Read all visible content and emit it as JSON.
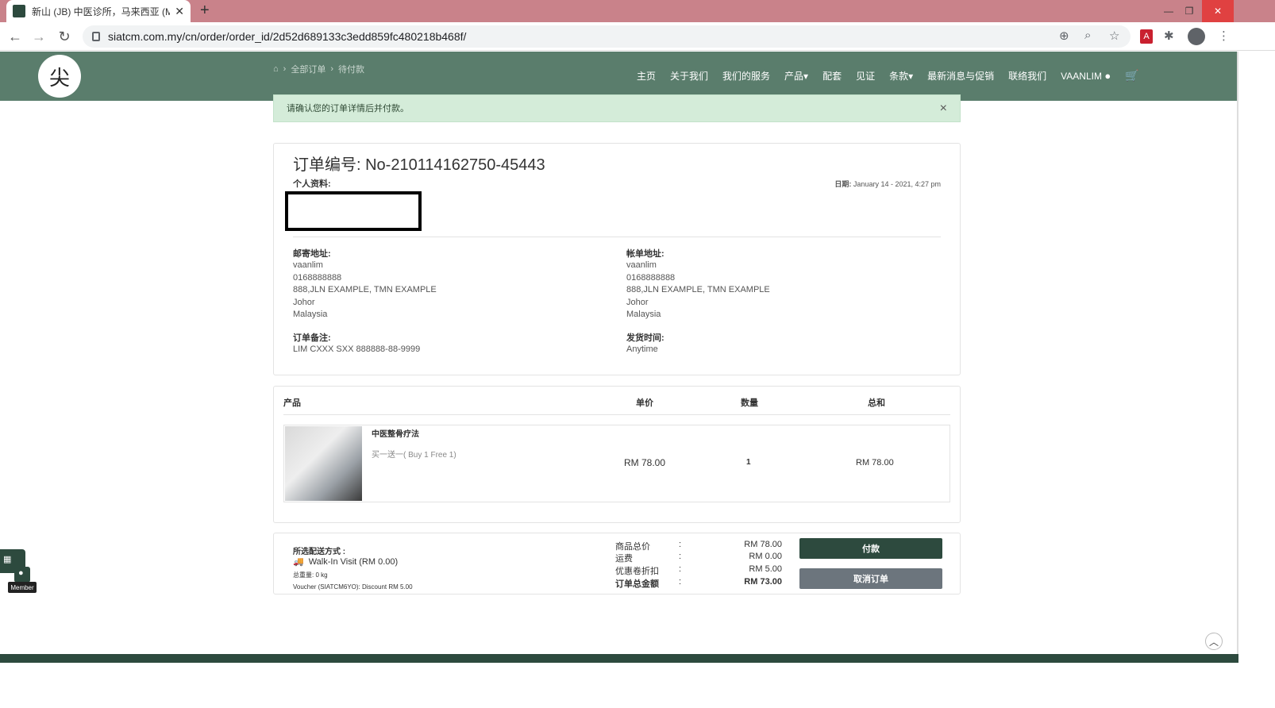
{
  "browser": {
    "tab_title": "新山 (JB) 中医诊所，马来西亚 (M",
    "tab_close": "✕",
    "new_tab": "+",
    "url": "siatcm.com.my/cn/order/order_id/2d52d689133c3edd859fc480218b468f/",
    "window_min": "—",
    "window_restore": "❐",
    "window_close": "✕"
  },
  "header": {
    "logo_glyph": "尖",
    "breadcrumb": [
      "⌂",
      "全部订单",
      "待付款"
    ],
    "menu": [
      "主页",
      "关于我们",
      "我们的服务",
      "产品▾",
      "配套",
      "见证",
      "条款▾",
      "最新消息与促销",
      "联络我们",
      "VAANLIM"
    ]
  },
  "alert": {
    "text": "请确认您的订单详情后并付款。",
    "close": "×"
  },
  "order": {
    "title": "订单编号: No-210114162750-45443",
    "profile_label": "个人资料:",
    "date_label": "日期:",
    "date_value": "January 14 - 2021, 4:27 pm",
    "shipping": {
      "label": "邮寄地址:",
      "lines": [
        "vaanlim",
        "0168888888",
        "888,JLN EXAMPLE, TMN EXAMPLE",
        "Johor",
        "Malaysia"
      ]
    },
    "billing": {
      "label": "帐单地址:",
      "lines": [
        "vaanlim",
        "0168888888",
        "888,JLN EXAMPLE, TMN EXAMPLE",
        "Johor",
        "Malaysia"
      ]
    },
    "note_label": "订单备注:",
    "note_value": "LIM CXXX SXX 888888-88-9999",
    "delivery_time_label": "发货时间:",
    "delivery_time_value": "Anytime"
  },
  "products": {
    "headers": {
      "product": "产品",
      "unit_price": "单价",
      "qty": "数量",
      "total": "总和"
    },
    "items": [
      {
        "name": "中医整骨疗法",
        "variant": "买一送一( Buy 1 Free 1)",
        "unit_price": "RM 78.00",
        "qty": "1",
        "total": "RM 78.00"
      }
    ]
  },
  "summary": {
    "shipping_method_label": "所选配送方式 :",
    "shipping_method": "Walk-In Visit (RM 0.00)",
    "weight": "总重量: 0 kg",
    "voucher": "Voucher (SIATCM6YO): Discount RM 5.00",
    "rows": [
      {
        "k": "商品总价",
        "c": ":",
        "v": "RM 78.00"
      },
      {
        "k": "运费",
        "c": ":",
        "v": "RM 0.00"
      },
      {
        "k": "优惠卷折扣",
        "c": ":",
        "v": "RM 5.00"
      },
      {
        "k": "订单总金额",
        "c": ":",
        "v": "RM 73.00"
      }
    ],
    "pay_label": "付款",
    "cancel_label": "取消订单"
  },
  "widgets": {
    "member_label": "Member",
    "to_top": "︿"
  }
}
